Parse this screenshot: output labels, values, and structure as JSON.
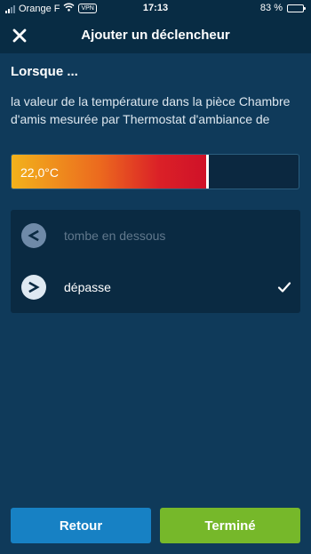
{
  "status_bar": {
    "carrier": "Orange F",
    "vpn": "VPN",
    "time": "17:13",
    "battery": "83 %",
    "battery_level": 0.83
  },
  "header": {
    "title": "Ajouter un déclencheur",
    "close_icon": "close-icon"
  },
  "section": {
    "title": "Lorsque ...",
    "description": "la valeur de la température  dans la pièce Chambre d'amis mesurée par Thermostat d'ambiance de"
  },
  "temperature": {
    "value_label": "22,0°C",
    "level": 0.68
  },
  "options": [
    {
      "label": "tombe en dessous",
      "icon": "less-than-icon",
      "selected": false
    },
    {
      "label": "dépasse",
      "icon": "greater-than-icon",
      "selected": true
    }
  ],
  "buttons": {
    "back": "Retour",
    "done": "Terminé"
  },
  "colors": {
    "background": "#0f3a5a",
    "header": "#082c44",
    "back_button": "#1781c4",
    "done_button": "#76b82a"
  }
}
